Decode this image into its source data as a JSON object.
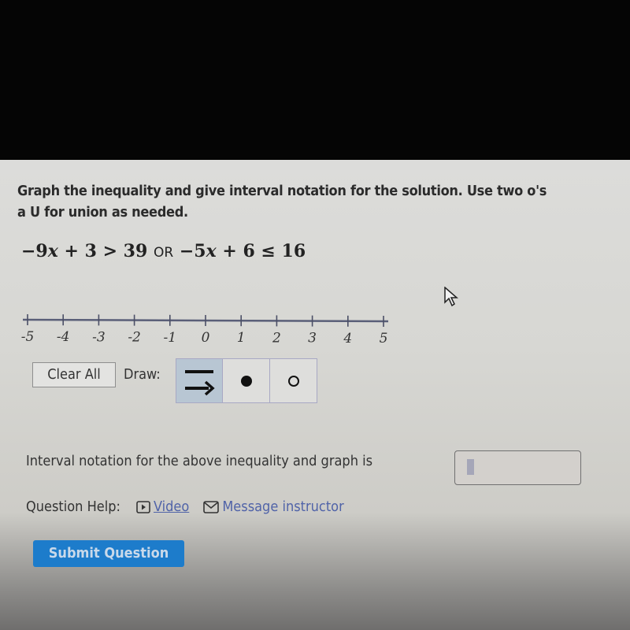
{
  "question": {
    "instructions_line1": "Graph the inequality and give interval notation for the solution. Use two o's",
    "instructions_line2": "a U for union as needed.",
    "equation": {
      "part1_coef": "−9",
      "part1_var": "x",
      "part1_rest": " + 3 > 39 ",
      "connector": "OR",
      "part2_coef": " −5",
      "part2_var": "x",
      "part2_rest": " + 6 ≤ 16"
    }
  },
  "number_line": {
    "min": -5,
    "max": 5,
    "ticks": [
      "-5",
      "-4",
      "-3",
      "-2",
      "-1",
      "0",
      "1",
      "2",
      "3",
      "4",
      "5"
    ]
  },
  "toolbar": {
    "clear_all_label": "Clear All",
    "draw_label": "Draw:",
    "tools": [
      {
        "name": "ray-tool",
        "icon": "line-ray-icon",
        "active": true
      },
      {
        "name": "closed-dot-tool",
        "icon": "filled-circle-icon",
        "active": false
      },
      {
        "name": "open-dot-tool",
        "icon": "open-circle-icon",
        "active": false
      }
    ]
  },
  "answer": {
    "label": "Interval notation for the above inequality and graph is",
    "value": ""
  },
  "help": {
    "label": "Question Help:",
    "video_label": "Video",
    "message_label": "Message instructor"
  },
  "submit_label": "Submit Question",
  "colors": {
    "submit_bg": "#1d7ccb",
    "link": "#5063a8",
    "active_tool_bg": "#b8c6d3"
  }
}
